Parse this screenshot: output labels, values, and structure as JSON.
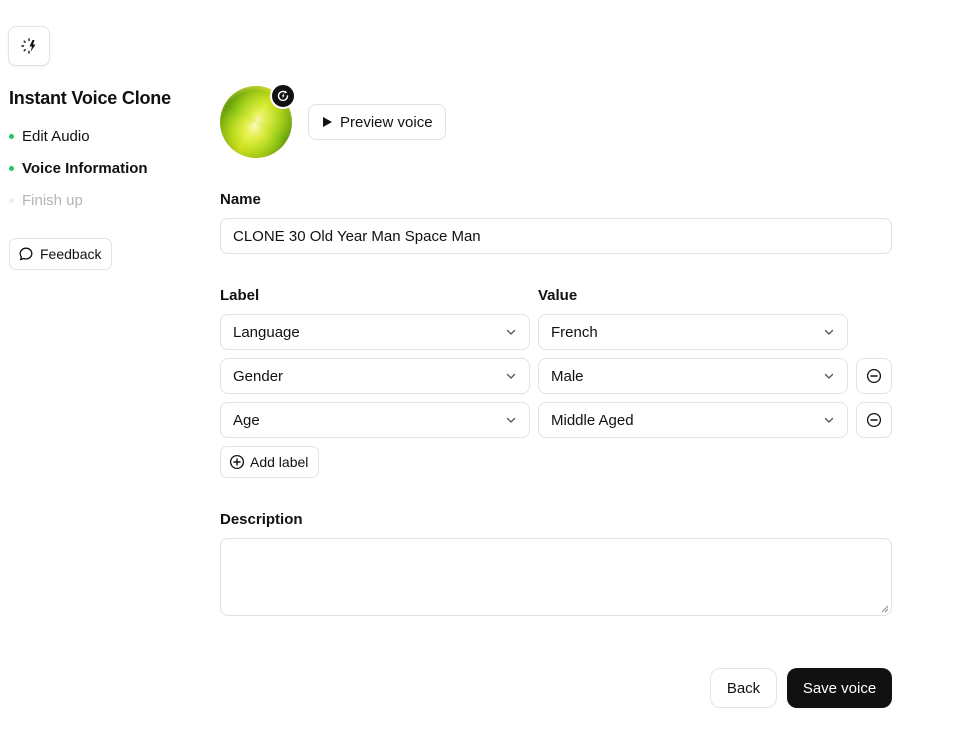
{
  "sidebar": {
    "title": "Instant Voice Clone",
    "steps": [
      {
        "label": "Edit Audio",
        "state": "done"
      },
      {
        "label": "Voice Information",
        "state": "active"
      },
      {
        "label": "Finish up",
        "state": "pending"
      }
    ],
    "feedback_label": "Feedback"
  },
  "voice": {
    "preview_label": "Preview voice"
  },
  "form": {
    "name_label": "Name",
    "name_value": "CLONE 30 Old Year Man Space Man",
    "label_header": "Label",
    "value_header": "Value",
    "rows": [
      {
        "label": "Language",
        "value": "French"
      },
      {
        "label": "Gender",
        "value": "Male"
      },
      {
        "label": "Age",
        "value": "Middle Aged"
      }
    ],
    "add_label": "Add label",
    "description_label": "Description",
    "description_value": ""
  },
  "footer": {
    "back_label": "Back",
    "save_label": "Save voice"
  },
  "colors": {
    "accent_dot": "#22c55e",
    "primary_button": "#111111"
  }
}
